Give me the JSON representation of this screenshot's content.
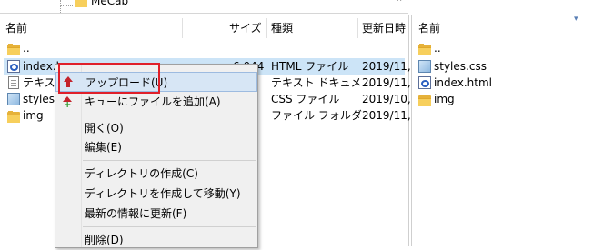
{
  "tree": {
    "partial_label": "MeCab",
    "scroll_up": "⌃"
  },
  "left": {
    "headers": {
      "name": "名前",
      "size": "サイズ",
      "type": "種類",
      "modified": "更新日時"
    },
    "rows": [
      {
        "name": "..",
        "size": "",
        "type": "",
        "modified": ""
      },
      {
        "name": "index.h",
        "size": "6,044",
        "type": "HTML ファイル",
        "modified": "2019/11,"
      },
      {
        "name": "テキスト",
        "size": "",
        "type": "テキスト ドキュメ...",
        "modified": "2019/11,"
      },
      {
        "name": "styles",
        "size": "",
        "type": "CSS ファイル",
        "modified": "2019/10,"
      },
      {
        "name": "img",
        "size": "",
        "type": "ファイル フォルダー",
        "modified": "2019/11,"
      }
    ]
  },
  "right": {
    "headers": {
      "name": "名前"
    },
    "rows": [
      {
        "name": ".."
      },
      {
        "name": "styles.css"
      },
      {
        "name": "index.html"
      },
      {
        "name": "img"
      }
    ]
  },
  "context_menu": {
    "items": [
      {
        "label": "アップロード(U)"
      },
      {
        "label": "キューにファイルを追加(A)"
      },
      {
        "label": "開く(O)"
      },
      {
        "label": "編集(E)"
      },
      {
        "label": "ディレクトリの作成(C)"
      },
      {
        "label": "ディレクトリを作成して移動(Y)"
      },
      {
        "label": "最新の情報に更新(F)"
      },
      {
        "label": "削除(D)"
      }
    ]
  },
  "colors": {
    "selection": "#cce4f7",
    "highlight_box": "#e0202a",
    "upload_arrow": "#c4232b"
  }
}
